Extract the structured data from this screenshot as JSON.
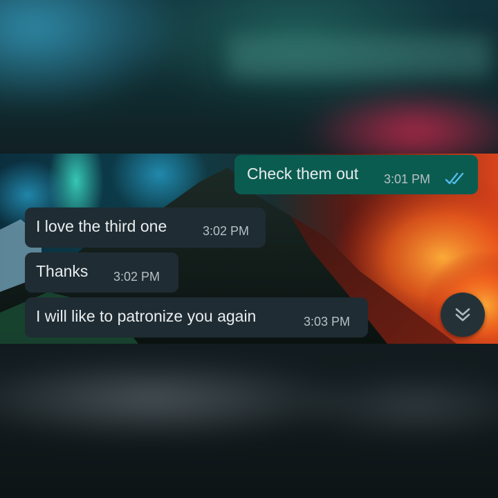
{
  "colors": {
    "outgoing_bubble": "#0b5c50",
    "incoming_bubble": "#1f2c33",
    "message_text": "#e9edef",
    "timestamp_text": "#b7c0c5",
    "read_receipt": "#53bdeb"
  },
  "messages": [
    {
      "direction": "outgoing",
      "text": "Check them out",
      "time": "3:01 PM",
      "status_icon": "double-check-read-icon"
    },
    {
      "direction": "incoming",
      "text": "I love the third one",
      "time": "3:02 PM"
    },
    {
      "direction": "incoming",
      "text": "Thanks",
      "time": "3:02 PM"
    },
    {
      "direction": "incoming",
      "text": "I will like to patronize you again",
      "time": "3:03 PM"
    }
  ],
  "scroll_button": {
    "icon": "double-chevron-down-icon"
  },
  "wallpaper": {
    "description_icon": "aurora-volcano-wallpaper"
  }
}
